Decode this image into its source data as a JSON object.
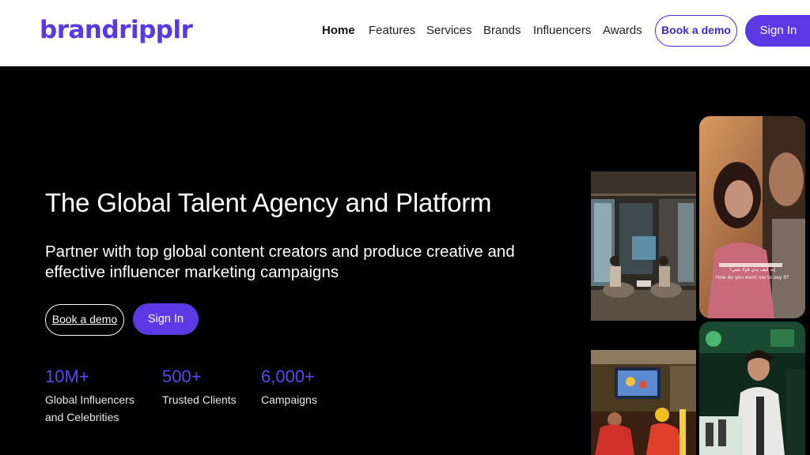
{
  "header": {
    "logo": "brandripplr",
    "nav": [
      {
        "label": "Home",
        "active": true
      },
      {
        "label": "Features"
      },
      {
        "label": "Services"
      },
      {
        "label": "Brands"
      },
      {
        "label": "Influencers"
      },
      {
        "label": "Awards"
      }
    ],
    "book_demo": "Book a demo",
    "sign_in": "Sign In"
  },
  "hero": {
    "title": "The Global Talent Agency and Platform",
    "subtitle": "Partner with top global content creators and produce creative and effective influencer marketing campaigns",
    "book_demo": "Book a demo",
    "sign_in": "Sign In",
    "stats": [
      {
        "value": "10M+",
        "label_line1": "Global Influencers",
        "label_line2": "and Celebrities"
      },
      {
        "value": "500+",
        "label_line1": "Trusted Clients",
        "label_line2": ""
      },
      {
        "value": "6,000+",
        "label_line1": "Campaigns",
        "label_line2": ""
      }
    ]
  },
  "media": {
    "subtitle_ar": "إيه كيف بدي قولا يعني؟",
    "subtitle_en": "How do you want me to say it?"
  },
  "colors": {
    "accent": "#5b3ae6",
    "accent_text": "#5b45f0",
    "background": "#000000"
  }
}
